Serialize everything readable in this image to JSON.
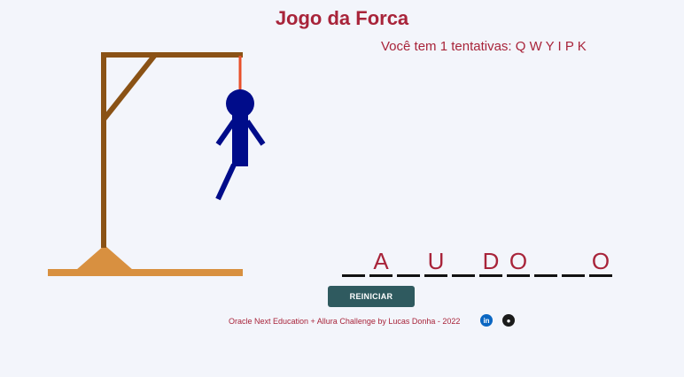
{
  "header": {
    "title": "Jogo da Forca"
  },
  "status": {
    "text": "Você tem 1 tentativas:",
    "wrong_letters": "Q W Y I P K",
    "attempts_remaining": 1
  },
  "word": {
    "slots": [
      "",
      "A",
      "",
      "U",
      "",
      "D",
      "O",
      "",
      "",
      "O"
    ]
  },
  "controls": {
    "restart_label": "REINICIAR"
  },
  "footer": {
    "credit": "Oracle Next Education + Allura Challenge by Lucas Donha - 2022",
    "links": [
      {
        "name": "linkedin",
        "icon": "linkedin-icon",
        "glyph": "in"
      },
      {
        "name": "github",
        "icon": "github-icon",
        "glyph": "●"
      }
    ]
  },
  "colors": {
    "accent": "#a8243a",
    "gallows_wood": "#8a5215",
    "gallows_base": "#d89040",
    "rope": "#e8502a",
    "figure": "#000c8a",
    "button": "#2f5a5f"
  }
}
